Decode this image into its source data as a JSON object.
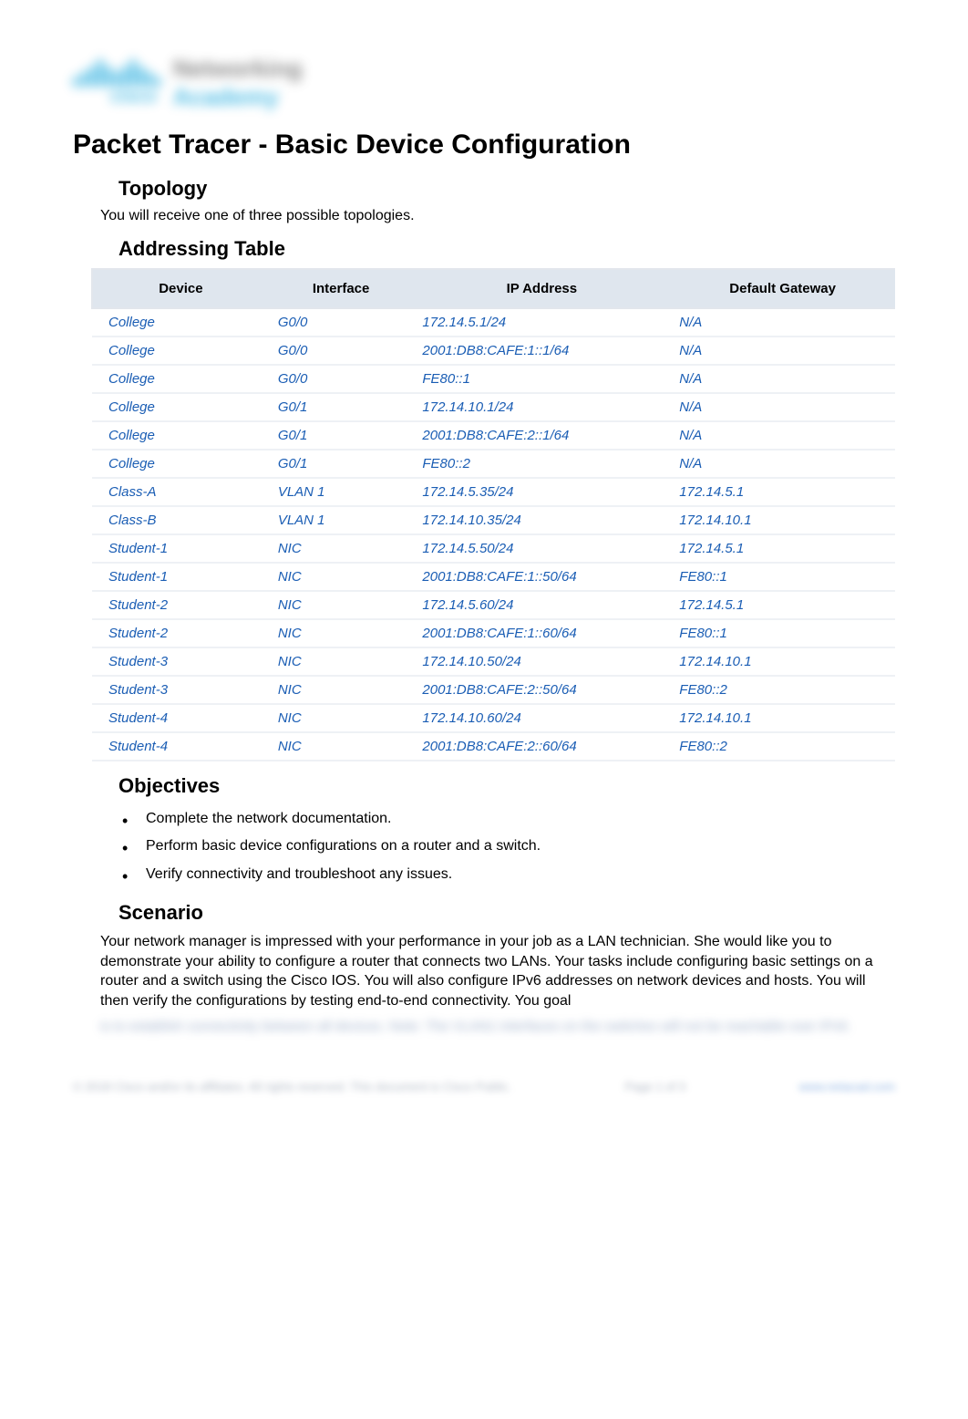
{
  "logo": {
    "brand_line1": "Networking",
    "brand_line2": "Academy",
    "cisco": "cisco"
  },
  "title": "Packet Tracer - Basic Device Configuration",
  "sections": {
    "topology": "Topology",
    "addressing": "Addressing Table",
    "objectives": "Objectives",
    "scenario": "Scenario"
  },
  "intro": "You will receive one of three possible topologies.",
  "table": {
    "headers": {
      "device": "Device",
      "interface": "Interface",
      "ip": "IP Address",
      "gateway": "Default Gateway"
    },
    "rows": [
      {
        "device": "College",
        "interface": "G0/0",
        "ip": "172.14.5.1/24",
        "gateway": "N/A"
      },
      {
        "device": "College",
        "interface": "G0/0",
        "ip": "2001:DB8:CAFE:1::1/64",
        "gateway": "N/A"
      },
      {
        "device": "College",
        "interface": "G0/0",
        "ip": "FE80::1",
        "gateway": "N/A"
      },
      {
        "device": "College",
        "interface": "G0/1",
        "ip": "172.14.10.1/24",
        "gateway": "N/A"
      },
      {
        "device": "College",
        "interface": "G0/1",
        "ip": "2001:DB8:CAFE:2::1/64",
        "gateway": "N/A"
      },
      {
        "device": "College",
        "interface": "G0/1",
        "ip": "FE80::2",
        "gateway": "N/A"
      },
      {
        "device": "Class-A",
        "interface": "VLAN 1",
        "ip": "172.14.5.35/24",
        "gateway": "172.14.5.1"
      },
      {
        "device": "Class-B",
        "interface": "VLAN 1",
        "ip": "172.14.10.35/24",
        "gateway": "172.14.10.1"
      },
      {
        "device": "Student-1",
        "interface": "NIC",
        "ip": "172.14.5.50/24",
        "gateway": "172.14.5.1"
      },
      {
        "device": "Student-1",
        "interface": "NIC",
        "ip": "2001:DB8:CAFE:1::50/64",
        "gateway": "FE80::1"
      },
      {
        "device": "Student-2",
        "interface": "NIC",
        "ip": "172.14.5.60/24",
        "gateway": "172.14.5.1"
      },
      {
        "device": "Student-2",
        "interface": "NIC",
        "ip": "2001:DB8:CAFE:1::60/64",
        "gateway": "FE80::1"
      },
      {
        "device": "Student-3",
        "interface": "NIC",
        "ip": "172.14.10.50/24",
        "gateway": "172.14.10.1"
      },
      {
        "device": "Student-3",
        "interface": "NIC",
        "ip": "2001:DB8:CAFE:2::50/64",
        "gateway": "FE80::2"
      },
      {
        "device": "Student-4",
        "interface": "NIC",
        "ip": "172.14.10.60/24",
        "gateway": "172.14.10.1"
      },
      {
        "device": "Student-4",
        "interface": "NIC",
        "ip": "2001:DB8:CAFE:2::60/64",
        "gateway": "FE80::2"
      }
    ]
  },
  "objectives_list": [
    "Complete the network documentation.",
    "Perform basic device configurations on a router and a switch.",
    "Verify connectivity and troubleshoot any issues."
  ],
  "scenario_text": "Your network manager is impressed with your performance in your job as a LAN technician. She would like you to demonstrate your ability to configure a router that connects two LANs. Your tasks include configuring basic settings on a router and a switch using the Cisco IOS. You will also configure IPv6 addresses on network devices and hosts. You will then verify the configurations by testing end-to-end connectivity. You goal",
  "blurred_tail": "is to establish connectivity between all devices.\nNote: The VLAN1 interfaces on the switches will not be reachable over IPv6.",
  "footer": {
    "left": "© 2018 Cisco and/or its affiliates. All rights reserved. This document is Cisco Public.",
    "center": "Page 1 of 3",
    "right": "www.netacad.com"
  }
}
